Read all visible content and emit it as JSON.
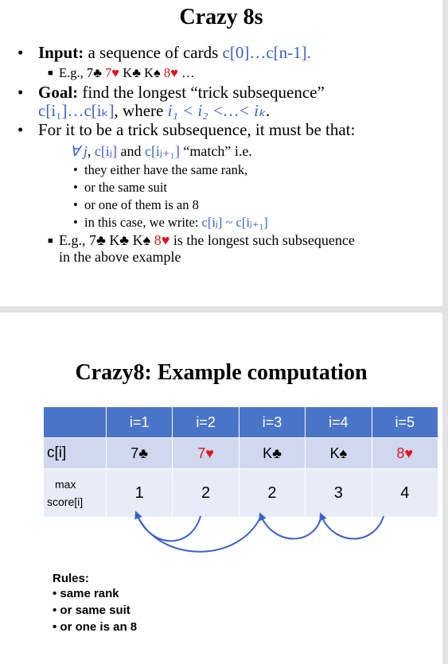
{
  "slide1": {
    "title": "Crazy 8s",
    "input": {
      "label": "Input:",
      "text": " a sequence of cards ",
      "seq": "c[0]…c[n-1]."
    },
    "example1": {
      "prefix": "E.g., ",
      "cards": [
        {
          "t": "7♣",
          "c": "black"
        },
        {
          "t": "7♥",
          "c": "red"
        },
        {
          "t": "K♣",
          "c": "black"
        },
        {
          "t": "K♠",
          "c": "black"
        },
        {
          "t": "8♥",
          "c": "red"
        }
      ],
      "suffix": " …"
    },
    "goal": {
      "label": "Goal:",
      "text": " find the longest “trick subsequence”"
    },
    "goal_line2": {
      "seq": "c[i₁]…c[iₖ]",
      "mid": ", where ",
      "cond": "i₁ < i₂ <…< iₖ",
      "end": "."
    },
    "trick": "For it to be a trick subsequence, it must be that:",
    "forall": {
      "q": "∀ j",
      "comma": ", ",
      "a": "c[iⱼ]",
      "and": " and ",
      "b": "c[iⱼ₊₁]",
      "rest": " “match” i.e."
    },
    "rules": [
      "they either have the same rank,",
      "or the same suit",
      "or one of them is an 8"
    ],
    "write": {
      "text": "in this case, we write: ",
      "formula": "c[iⱼ] ~ c[iⱼ₊₁]"
    },
    "example2": {
      "prefix": "E.g., ",
      "cards": [
        {
          "t": "7♣",
          "c": "black"
        },
        {
          "t": "K♣",
          "c": "black"
        },
        {
          "t": "K♠",
          "c": "black"
        },
        {
          "t": "8♥",
          "c": "red"
        }
      ],
      "suffix": " is the longest such subsequence",
      "line2": "in the above example"
    }
  },
  "slide2": {
    "title": "Crazy8: Example computation",
    "headers": [
      "i=1",
      "i=2",
      "i=3",
      "i=4",
      "i=5"
    ],
    "ci_label": "c[i]",
    "cards": [
      {
        "t": "7♣",
        "c": "black"
      },
      {
        "t": "7♥",
        "c": "red"
      },
      {
        "t": "K♣",
        "c": "black"
      },
      {
        "t": "K♠",
        "c": "black"
      },
      {
        "t": "8♥",
        "c": "red"
      }
    ],
    "score_label_1": "max",
    "score_label_2": "score[i]",
    "scores": [
      "1",
      "2",
      "2",
      "3",
      "4"
    ],
    "rules_title": "Rules:",
    "rules": [
      "same rank",
      "or same suit",
      "or one is an 8"
    ]
  },
  "colors": {
    "blue_text": "#3a5fd0",
    "red_suit": "#e0141e",
    "table_header": "#4a74c8",
    "table_row1": "#cfd8ee",
    "table_row2": "#e8ecf6",
    "arrow": "#3a5fd0"
  }
}
